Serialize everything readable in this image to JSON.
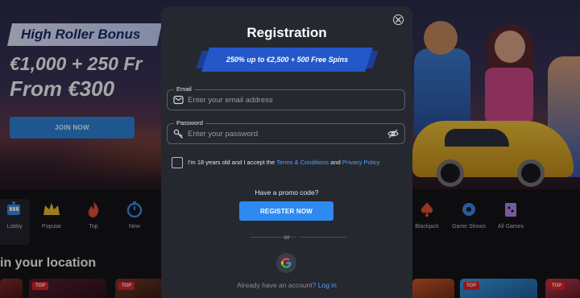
{
  "hero": {
    "bonus_tag": "High Roller Bonus",
    "line1": "€1,000 + 250 Fr",
    "line2": "From €300",
    "join_button": "JOIN NOW"
  },
  "categories": [
    {
      "label": "Lobby",
      "icon": "slot-machine-icon",
      "active": true
    },
    {
      "label": "Popular",
      "icon": "crown-icon"
    },
    {
      "label": "Top",
      "icon": "flame-icon"
    },
    {
      "label": "New",
      "icon": "stopwatch-icon"
    },
    {
      "label": "Blackjack",
      "icon": "spade-card-icon"
    },
    {
      "label": "Game Shows",
      "icon": "game-show-icon"
    },
    {
      "label": "All Games",
      "icon": "games-grid-icon"
    }
  ],
  "location_heading": "in your location",
  "tile_badge": "TOP",
  "modal": {
    "title": "Registration",
    "promo_banner": "250% up to €2,500 + 500 Free Spins",
    "email": {
      "label": "Email",
      "placeholder": "Enter your email address",
      "value": ""
    },
    "password": {
      "label": "Password",
      "placeholder": "Enter your password",
      "value": ""
    },
    "terms": {
      "prefix": "I'm 18 years old and I accept the",
      "terms_link": "Terms & Conditions",
      "and": "and",
      "privacy_link": "Privacy Policy"
    },
    "promo_question": "Have a promo code?",
    "register_button": "REGISTER NOW",
    "or": "or",
    "login_prompt": "Already have an account?",
    "login_link": "Log in"
  },
  "colors": {
    "accent": "#2f8af0",
    "link": "#4da3ff",
    "modal_bg": "#262830",
    "banner": "#2457c8"
  }
}
